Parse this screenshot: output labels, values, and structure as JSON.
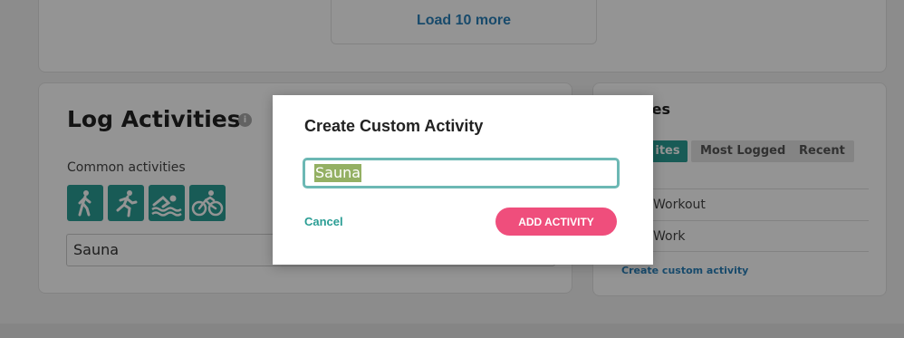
{
  "load_more": {
    "label": "Load 10 more"
  },
  "log_activities": {
    "title": "Log Activities",
    "info_icon": "i",
    "common_label": "Common activities",
    "common_icons": [
      "walking-icon",
      "running-icon",
      "swimming-icon",
      "cycling-icon"
    ],
    "input_value": "Sauna"
  },
  "favorites": {
    "title": "ities",
    "tabs": [
      {
        "label": "ites"
      },
      {
        "label": "Most Logged"
      },
      {
        "label": "Recent"
      }
    ],
    "items": [
      {
        "label": "Workout"
      },
      {
        "label": "Work"
      }
    ],
    "create_link": "Create custom activity"
  },
  "modal": {
    "title": "Create Custom Activity",
    "input_value": "Sauna",
    "cancel_label": "Cancel",
    "submit_label": "ADD ACTIVITY"
  },
  "colors": {
    "teal": "#2a9d94",
    "pink": "#ef4e7c",
    "link_blue": "#2a80b9"
  }
}
